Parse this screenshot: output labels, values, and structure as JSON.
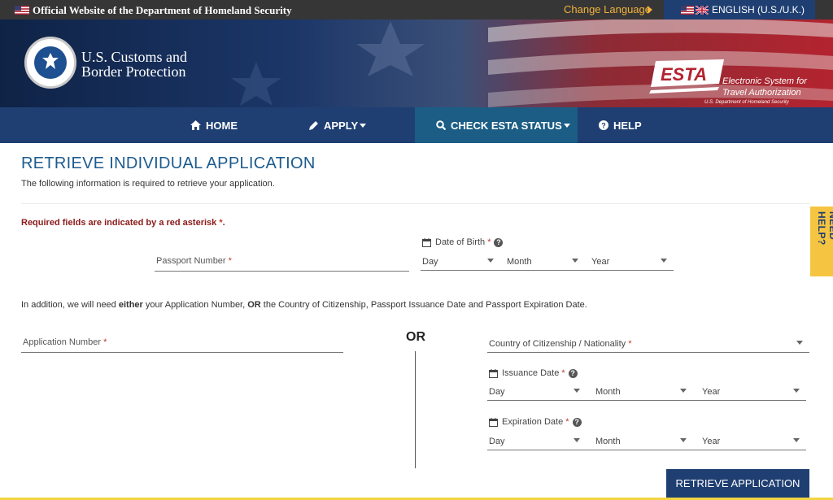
{
  "gov_banner": {
    "text": "Official Website of the Department of Homeland Security",
    "change_language": "Change Language",
    "language": "ENGLISH (U.S./U.K.)"
  },
  "header": {
    "cbp_line1": "U.S. Customs and",
    "cbp_line2": "Border Protection",
    "esta_logo": "ESTA",
    "esta_line1": "Electronic System for",
    "esta_line2": "Travel Authorization",
    "esta_line3": "U.S. Department of Homeland Security"
  },
  "nav": {
    "home": "HOME",
    "apply": "APPLY",
    "check_status": "CHECK ESTA STATUS",
    "help": "HELP"
  },
  "page": {
    "title": "RETRIEVE INDIVIDUAL APPLICATION",
    "subtitle": "The following information is required to retrieve your application.",
    "required_note": "Required fields are indicated by a red asterisk",
    "required_star": "*",
    "required_period": ".",
    "additional_1": "In addition, we will need ",
    "additional_either": "either",
    "additional_2": " your Application Number, ",
    "additional_or": "OR",
    "additional_3": " the Country of Citizenship, Passport Issuance Date and Passport Expiration Date."
  },
  "form": {
    "passport_number_label": "Passport Number",
    "dob_label": "Date of Birth",
    "application_number_label": "Application Number",
    "or_text": "OR",
    "country_label": "Country of Citizenship / Nationality",
    "issuance_label": "Issuance Date",
    "expiration_label": "Expiration Date",
    "day": "Day",
    "month": "Month",
    "year": "Year",
    "asterisk": "*",
    "retrieve_button": "RETRIEVE APPLICATION"
  },
  "side_tab": "NEED HELP?",
  "colors": {
    "navy": "#1f3f72",
    "active_nav": "#1b5d84",
    "title_blue": "#1c5b8f",
    "required_red": "#8b1a1a",
    "help_tab_yellow": "#f5c542"
  }
}
